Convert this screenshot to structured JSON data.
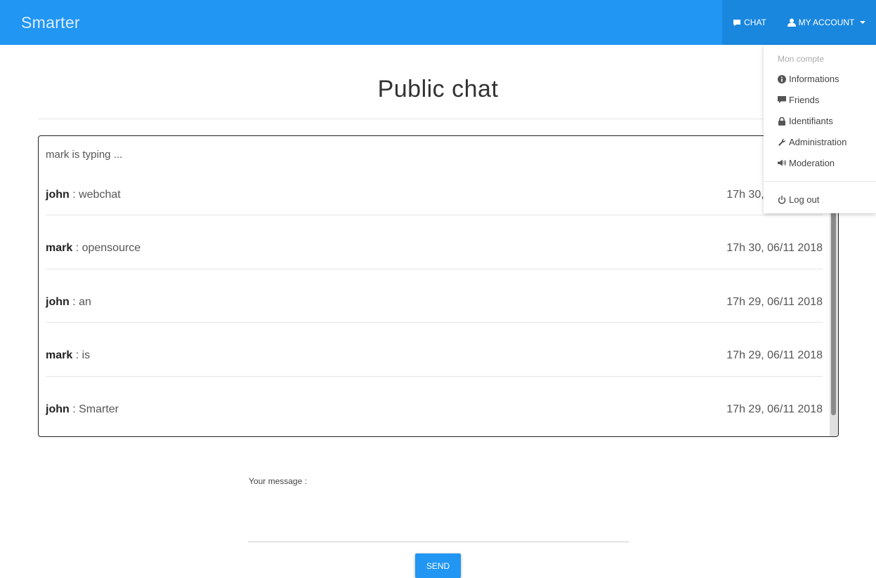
{
  "navbar": {
    "brand": "Smarter",
    "chat_label": "CHAT",
    "account_label": "MY ACCOUNT"
  },
  "page": {
    "title": "Public chat"
  },
  "chat": {
    "typing": "mark is typing ...",
    "messages": [
      {
        "author": "john",
        "text": " : webchat",
        "time": "17h 30, 06/11 2018"
      },
      {
        "author": "mark",
        "text": " : opensource",
        "time": "17h 30, 06/11 2018"
      },
      {
        "author": "john",
        "text": " : an",
        "time": "17h 29, 06/11 2018"
      },
      {
        "author": "mark",
        "text": " : is",
        "time": "17h 29, 06/11 2018"
      },
      {
        "author": "john",
        "text": " : Smarter",
        "time": "17h 29, 06/11 2018"
      }
    ]
  },
  "dropdown": {
    "header": "Mon compte",
    "items": [
      {
        "label": "Informations",
        "icon": "info-circle-icon"
      },
      {
        "label": "Friends",
        "icon": "comment-icon"
      },
      {
        "label": "Identifiants",
        "icon": "lock-icon"
      },
      {
        "label": "Administration",
        "icon": "wrench-icon"
      },
      {
        "label": "Moderation",
        "icon": "bullhorn-icon"
      }
    ],
    "logout": {
      "label": "Log out",
      "icon": "power-icon"
    }
  },
  "composer": {
    "label": "Your message :",
    "value": "",
    "send_label": "SEND"
  },
  "colors": {
    "primary": "#2196f3",
    "primary_dark": "#1a87de"
  }
}
